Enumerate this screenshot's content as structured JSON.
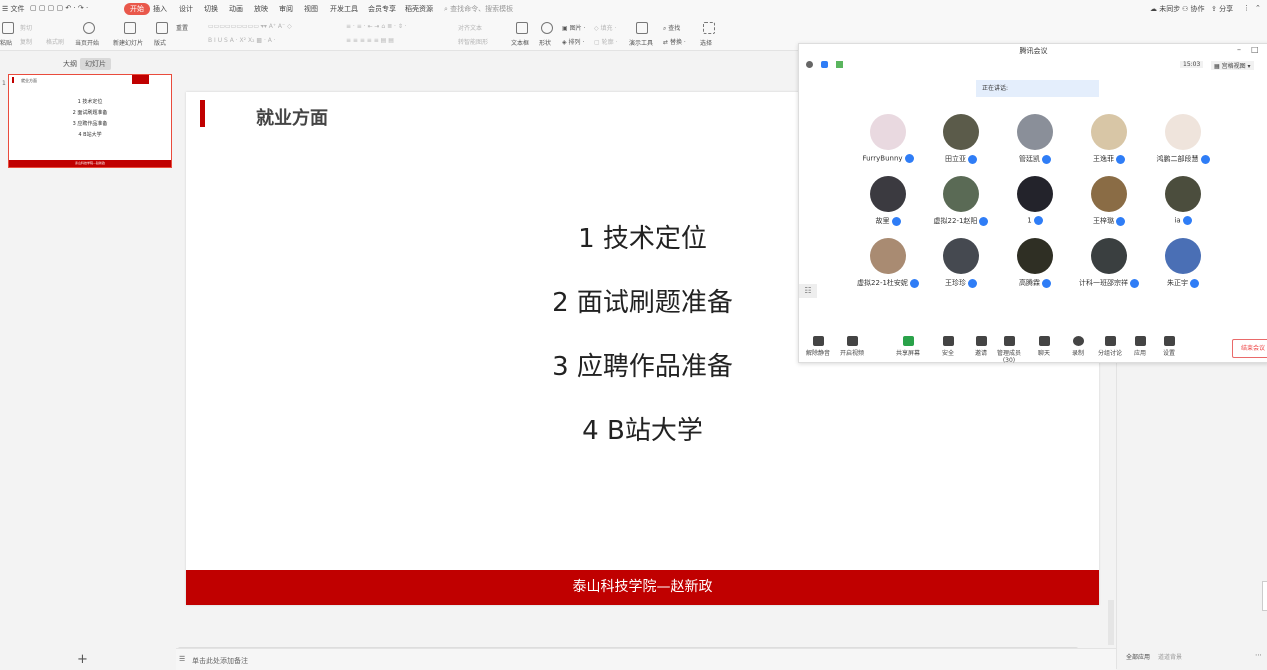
{
  "menu": {
    "file": "文件",
    "tabs": [
      "开始",
      "插入",
      "设计",
      "切换",
      "动画",
      "放映",
      "审阅",
      "视图",
      "开发工具",
      "会员专享",
      "稻壳资源"
    ],
    "search_placeholder": "查找命令、搜索模板",
    "right": [
      "未同步",
      "协作",
      "分享"
    ]
  },
  "ribbon": {
    "cut": "剪切",
    "copy": "复制",
    "painter": "格式刷",
    "paste": "粘贴",
    "from_start": "当页开始",
    "new_slide": "新建幻灯片",
    "layout": "版式",
    "reset": "重置",
    "textbox": "文本框",
    "shape": "形状",
    "picture": "图片",
    "arrange": "排列",
    "fill": "填充",
    "outline": "轮廓",
    "present_tools": "演示工具",
    "find": "查找",
    "replace": "替换",
    "select": "选择",
    "align_text": "对齐文本",
    "smart_shape": "转智能图形"
  },
  "left_panel": {
    "tab_outline": "大纲",
    "tab_slides": "幻灯片",
    "slide_number": "1",
    "add": "+"
  },
  "thumbnail": {
    "title": "就业方面",
    "items": [
      "1 技术定位",
      "2 面试刷题准备",
      "3 应聘作品准备",
      "4 B站大学"
    ],
    "footer": "泰山科技学院—赵新政"
  },
  "slide": {
    "title": "就业方面",
    "bullets": [
      "1 技术定位",
      "2 面试刷题准备",
      "3 应聘作品准备",
      "4 B站大学"
    ],
    "footer": "泰山科技学院—赵新政"
  },
  "notes": {
    "placeholder": "单击此处添加备注"
  },
  "meeting": {
    "title": "腾讯会议",
    "time": "15:03",
    "view": "宫格视图",
    "speaking": "正在讲话:",
    "participants": [
      {
        "name": "FurryBunny",
        "color": "#e9d9e0"
      },
      {
        "name": "田立亚",
        "color": "#5b5b4a"
      },
      {
        "name": "管廷凯",
        "color": "#8a8f99"
      },
      {
        "name": "王逸菲",
        "color": "#d8c6a6"
      },
      {
        "name": "鸿鹏二部段慧",
        "color": "#efe4dc"
      },
      {
        "name": "故里",
        "color": "#3b3a40"
      },
      {
        "name": "虚拟22-1赵阳",
        "color": "#5a6a55"
      },
      {
        "name": "1",
        "color": "#23232b"
      },
      {
        "name": "王梓璐",
        "color": "#8a6c45"
      },
      {
        "name": "ia",
        "color": "#4b4d3d"
      },
      {
        "name": "虚拟22-1杜安妮",
        "color": "#a98b72"
      },
      {
        "name": "王珍珍",
        "color": "#454950"
      },
      {
        "name": "高腾霖",
        "color": "#2f2f24"
      },
      {
        "name": "计科一班邵宗祥",
        "color": "#3a3f40"
      },
      {
        "name": "朱正宇",
        "color": "#4a6fb5"
      }
    ],
    "toolbar": [
      "解除静音",
      "开启视频",
      "共享屏幕",
      "安全",
      "邀请",
      "管理成员(30)",
      "聊天",
      "录制",
      "分组讨论",
      "应用",
      "设置"
    ],
    "end": "结束会议"
  },
  "right_panel": {
    "tabs": [
      "全部应用",
      "道道背景"
    ]
  }
}
